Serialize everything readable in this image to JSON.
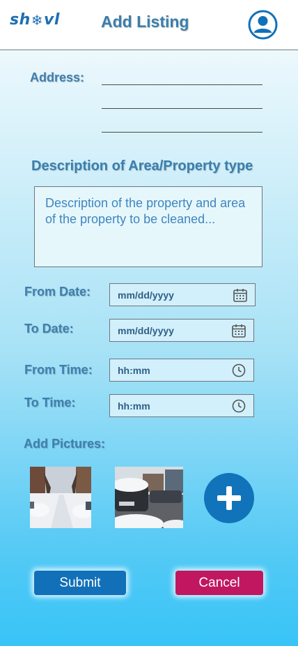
{
  "header": {
    "logo_left": "sh",
    "logo_right": "vl",
    "title": "Add Listing",
    "profile_icon": "user-circle-icon"
  },
  "form": {
    "address_label": "Address:",
    "description_title": "Description of Area/Property type",
    "description_placeholder": "Description of the property and area of the property to be cleaned...",
    "from_date_label": "From Date:",
    "to_date_label": "To Date:",
    "from_time_label": "From Time:",
    "to_time_label": "To Time:",
    "date_placeholder": "mm/dd/yyyy",
    "time_placeholder": "hh:mm",
    "add_pictures_label": "Add Pictures:"
  },
  "buttons": {
    "submit": "Submit",
    "cancel": "Cancel"
  },
  "colors": {
    "primary": "#1170b8",
    "cancel": "#c01760",
    "label": "#3f7fae"
  }
}
